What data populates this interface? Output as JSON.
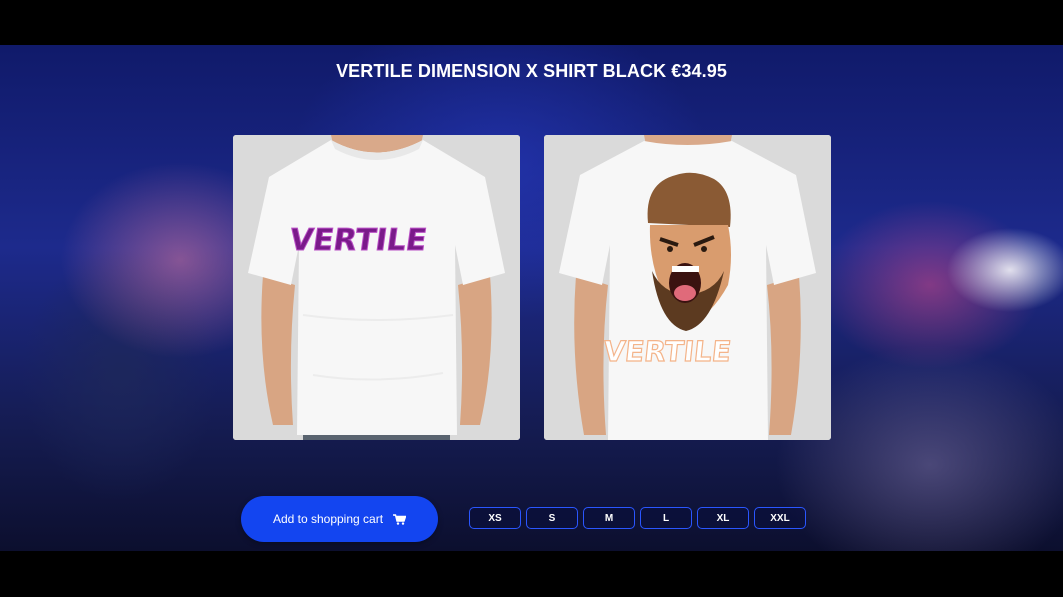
{
  "product": {
    "title": "VERTILE DIMENSION X SHIRT BLACK €34.95",
    "images": [
      {
        "name": "shirt-front",
        "print_text": "VERTILE",
        "print_color": "#7a1a8a"
      },
      {
        "name": "shirt-back",
        "print_text": "VERTILE",
        "print_color": "#f4b48a"
      }
    ]
  },
  "cart": {
    "label": "Add to shopping cart",
    "icon": "shopping-cart-icon"
  },
  "sizes": [
    "XS",
    "S",
    "M",
    "L",
    "XL",
    "XXL"
  ],
  "colors": {
    "accent": "#1345f0",
    "size_border": "#2a56ff"
  }
}
